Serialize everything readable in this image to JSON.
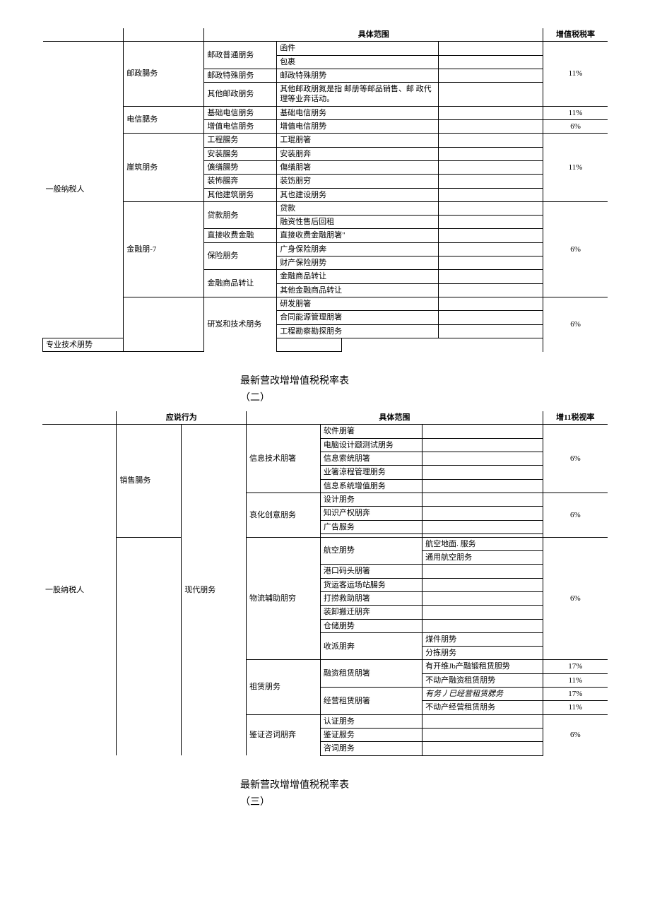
{
  "headers": {
    "scope": "具体范围",
    "rate1": "增值税税率",
    "behavior": "应说行为",
    "rate2": "增11税视率"
  },
  "taxpayer1": "一般纳税人",
  "taxpayer2": "一股纳税人",
  "t1": {
    "youzheng": {
      "label": "邮政腸务",
      "rate": "11%",
      "putong": {
        "label": "邮政普通朋务",
        "items": [
          "函件",
          "包裹"
        ]
      },
      "teshu": {
        "label": "邮政特殊朋务",
        "item": "邮政特殊朋势"
      },
      "qita": {
        "label": "其他邮政朋务",
        "item": "其他邮政朋氮是指 邮册等邮品销售、邮 政代理等业奔话动。"
      }
    },
    "dianxin": {
      "label": "电信腮务",
      "jichu": {
        "label": "基础电信朋务",
        "item": "基础电信朋务",
        "rate": "11%"
      },
      "zengzhi": {
        "label": "增值电信朋务",
        "item": "增值电信朋势",
        "rate": "6%"
      }
    },
    "jianzhu": {
      "label": "崖筑朋务",
      "rate": "11%",
      "rows": [
        {
          "c1": "工程腸务",
          "c2": "工琨朋箸"
        },
        {
          "c1": "安装腸务",
          "c2": "安装朋奔"
        },
        {
          "c1": "儣缮腸势",
          "c2": "傷缮朋箸"
        },
        {
          "c1": "装怖腸奔",
          "c2": "装饬朋穷"
        },
        {
          "c1": "其他建筑朋务",
          "c2": "其也建设朋务"
        }
      ]
    },
    "jinrong": {
      "label": "金融朋-7",
      "rate": "6%",
      "daikuan": {
        "label": "贷款朋务",
        "items": [
          "贷款",
          "融资性售后回租"
        ]
      },
      "zhijie": {
        "label": "直接收费金融",
        "item": "直接收费金融朋箸\""
      },
      "baoxian": {
        "label": "保险朋务",
        "items": [
          "广身保险朋奔",
          "财产保险朋势"
        ]
      },
      "zhuanrang": {
        "label": "金融商品转让",
        "items": [
          "金融商品转让",
          "其他金融商品转让"
        ]
      }
    },
    "yanfa": {
      "label": "研岌和技术朋务",
      "rate": "6%",
      "items": [
        "研发朋箸",
        "合同能源管理朋箸",
        "工程勘察勘探朋务",
        "专业技术朋势"
      ]
    }
  },
  "title2": {
    "a": "最新营改增增值税税率表",
    "b": "（二）"
  },
  "t2": {
    "xiaoshou": "销售腸务",
    "xiandai": "现代朋务",
    "xinxi": {
      "label": "信息技术朋箸",
      "rate": "6%",
      "items": [
        "软件朋箸",
        "电脑设计颋测试朋务",
        "信息索统朋箸",
        "业箸涼程管理朋务",
        "信息系统增值朋务"
      ]
    },
    "wenhua": {
      "label": "哀化创意朋务",
      "rate": "6%",
      "items": [
        "设计朋务",
        "知识产权朋奔",
        "广告服务",
        ""
      ]
    },
    "wuliu": {
      "label": "物流辅助朋穷",
      "rate": "6%",
      "hangkong": {
        "label": "航空朋势",
        "subs": [
          "航空地面. 服务",
          "通用航空朋务"
        ]
      },
      "items": [
        "港口码头朋箸",
        "货运客运场站腸务",
        "打捞救助朋箸",
        "装卸搬迁朋奔",
        "仓储朋势"
      ],
      "shoupai": {
        "label": "收派朋奔",
        "subs": [
          "煤件朋势",
          "分拣朋务"
        ]
      }
    },
    "zulin": {
      "label": "祖赁朋务",
      "rongzi": {
        "label": "融资租赁朋箸",
        "rows": [
          {
            "sub": "有开维Jb产融锻租赁胆势",
            "rate": "17%"
          },
          {
            "sub": "不动产融资租赁朋势",
            "rate": "11%"
          }
        ]
      },
      "jingying": {
        "label": "经营租赁朋箸",
        "rows": [
          {
            "sub": "有务丿巳经营租赁腮务",
            "rate": "17%",
            "italic": true
          },
          {
            "sub": "不动产经营租赁朋务",
            "rate": "11%"
          }
        ]
      }
    },
    "jianzheng": {
      "label": "鉴证咨词朋奔",
      "rate": "6%",
      "items": [
        "认证朋务",
        "鉴证服务",
        "咨词朋务"
      ]
    }
  },
  "title3": {
    "a": "最新营改增增值税税率表",
    "b": "（三）"
  }
}
